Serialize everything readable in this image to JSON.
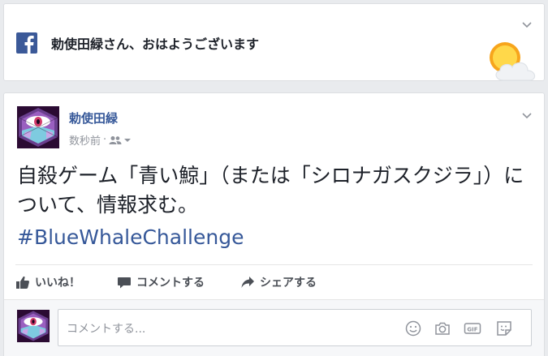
{
  "greeting": {
    "text": "勅使田緑さん、おはようございます"
  },
  "post": {
    "author": "勅使田緑",
    "timestamp": "数秒前",
    "separator": "·",
    "text": "自殺ゲーム「青い鯨」（または「シロナガスクジラ」）について、情報求む。",
    "hashtag": "#BlueWhaleChallenge"
  },
  "actions": {
    "like": "いいね！",
    "comment": "コメントする",
    "share": "シェアする"
  },
  "comment_box": {
    "placeholder": "コメントする..."
  },
  "colors": {
    "facebook_blue": "#3b5998",
    "link_blue": "#365899",
    "background": "#e9ebee",
    "avatar_bg": "#2b0b33"
  },
  "icons": {
    "brand": "facebook-logo-icon",
    "weather": "sun-cloud-icon",
    "audience": "friends-icon",
    "like": "thumbs-up-icon",
    "comment": "speech-bubble-icon",
    "share": "share-arrow-icon",
    "emoji": "smiley-icon",
    "photo": "camera-icon",
    "gif": "gif-icon",
    "sticker": "sticker-icon"
  }
}
